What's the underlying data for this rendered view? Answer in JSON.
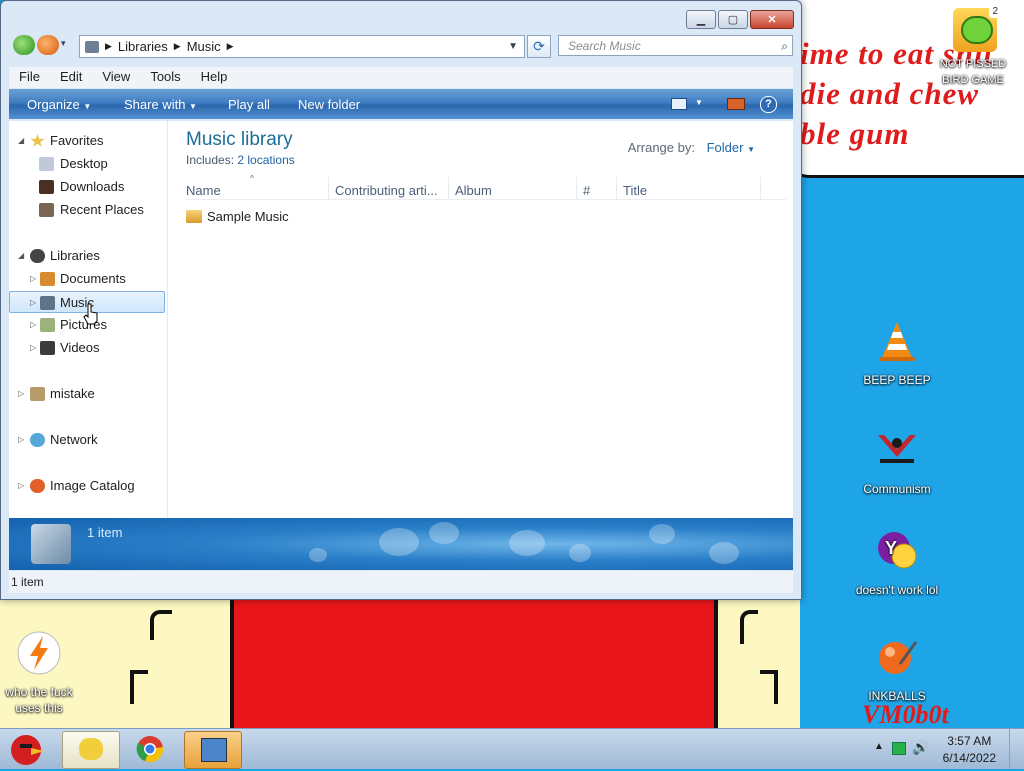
{
  "window": {
    "breadcrumb": [
      "Libraries",
      "Music"
    ],
    "search_placeholder": "Search Music",
    "menu": [
      "File",
      "Edit",
      "View",
      "Tools",
      "Help"
    ],
    "commands": [
      "Organize",
      "Share with",
      "Play all",
      "New folder"
    ],
    "nav": {
      "favorites": "Favorites",
      "desktop": "Desktop",
      "downloads": "Downloads",
      "recent": "Recent Places",
      "libraries": "Libraries",
      "documents": "Documents",
      "music": "Music",
      "pictures": "Pictures",
      "videos": "Videos",
      "mistake": "mistake",
      "network": "Network",
      "image_catalog": "Image Catalog"
    },
    "library_title": "Music library",
    "includes_label": "Includes:",
    "includes_link": "2 locations",
    "arrange_label": "Arrange by:",
    "arrange_value": "Folder",
    "columns": [
      "Name",
      "Contributing arti...",
      "Album",
      "#",
      "Title"
    ],
    "items": [
      "Sample Music"
    ],
    "details_count": "1 item",
    "status": "1 item"
  },
  "desktop": {
    "wallpaper_lines": [
      "ime to eat shit",
      "die and chew",
      "ble gum"
    ],
    "icons": {
      "pigs": "NOT PISSED BIRD GAME",
      "pigs_badge": "2",
      "vlc": "BEEP BEEP",
      "communism": "Communism",
      "yahoo": "doesn't work lol",
      "inkballs": "INKBALLS",
      "flash": "who the fuck uses this"
    },
    "watermark": "VM0b0t"
  },
  "taskbar": {
    "time": "3:57 AM",
    "date": "6/14/2022"
  },
  "colors": {
    "accent": "#2064a8",
    "desktop": "#1ea5e8"
  }
}
